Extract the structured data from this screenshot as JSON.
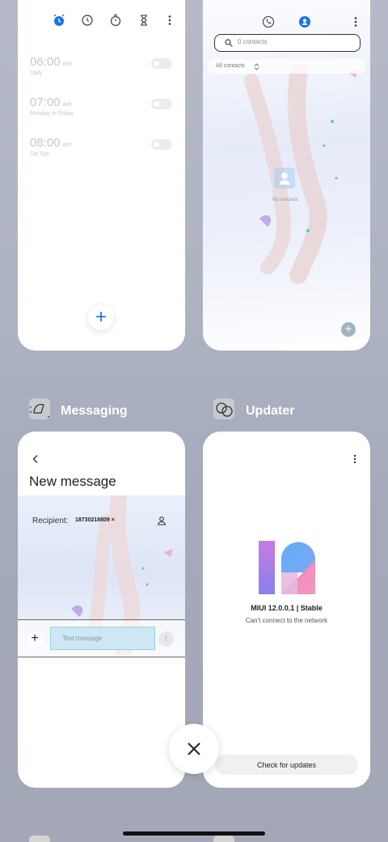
{
  "clock": {
    "alarms": [
      {
        "time": "06:00",
        "ampm": "am",
        "days": "Daily"
      },
      {
        "time": "07:00",
        "ampm": "am",
        "days": "Monday to Friday"
      },
      {
        "time": "08:00",
        "ampm": "am",
        "days": "Sat Sun"
      }
    ],
    "tabs": [
      "alarm-icon",
      "clock-icon",
      "stopwatch-icon",
      "timer-icon"
    ],
    "fab_icon": "+",
    "accent": "#1a73e8"
  },
  "contacts": {
    "search_placeholder": "0 contacts",
    "filter_label": "All contacts",
    "empty_label": "No contacts",
    "tabs": [
      "phone-icon",
      "contacts-icon"
    ]
  },
  "messaging": {
    "app_label": "Messaging",
    "title": "New message",
    "recipient_label": "Recipient:",
    "recipient_value": "18730218809 ×",
    "text_placeholder": "Text message"
  },
  "updater": {
    "app_label": "Updater",
    "version": "MIUI 12.0.0.1 | Stable",
    "status": "Can't connect to the network",
    "check_button": "Check for updates"
  },
  "close_icon": "close-icon"
}
